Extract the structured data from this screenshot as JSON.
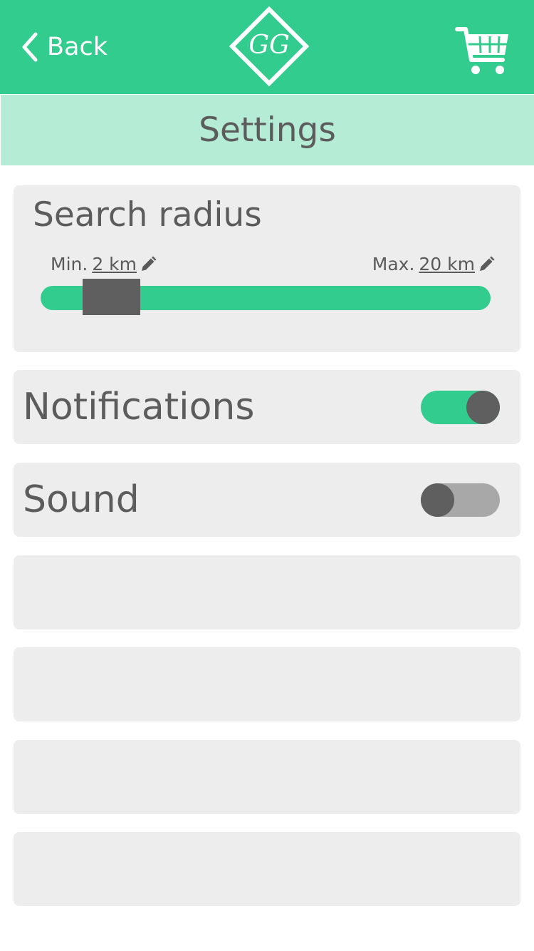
{
  "header": {
    "back_label": "Back",
    "logo_text": "GG",
    "brand_color": "#33cc8f",
    "back_icon": "chevron-left-icon",
    "cart_icon": "shopping-cart-icon"
  },
  "subheader": {
    "title": "Settings",
    "color": "#b5ecd6"
  },
  "search_radius": {
    "title": "Search radius",
    "min_prefix": "Min.",
    "min_value": "2 km",
    "max_prefix": "Max.",
    "max_value": "20 km",
    "edit_icon": "pencil-icon"
  },
  "settings": {
    "notifications": {
      "label": "Notifications",
      "enabled": true
    },
    "sound": {
      "label": "Sound",
      "enabled": false
    }
  }
}
